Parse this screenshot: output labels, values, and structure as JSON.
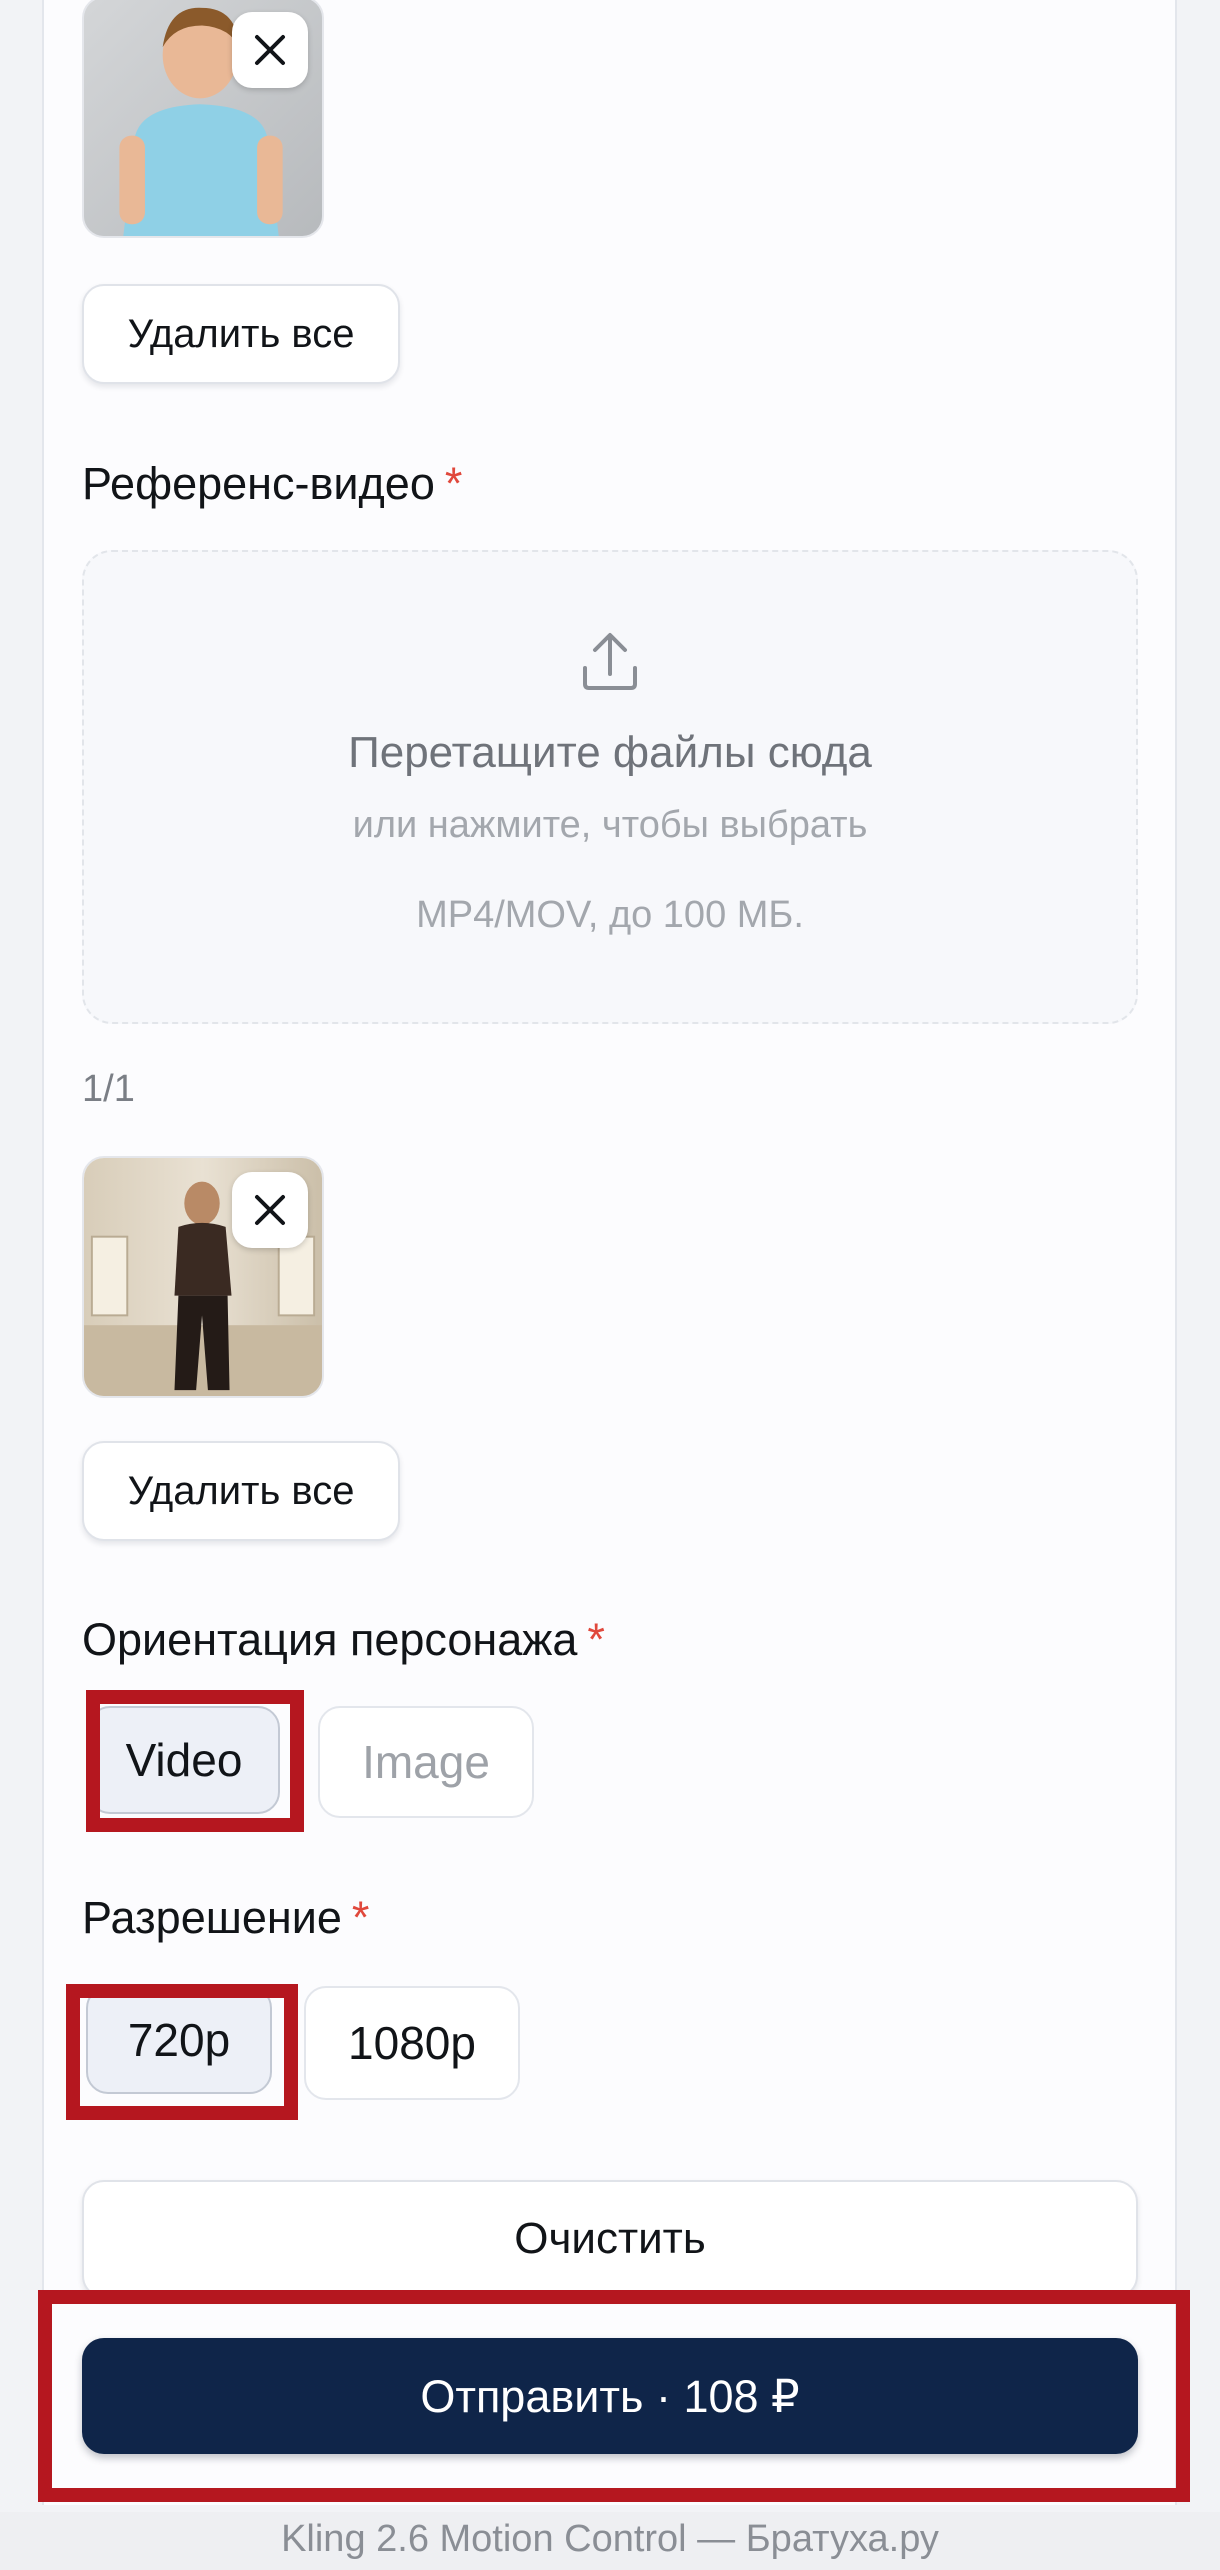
{
  "upload_character": {
    "delete_all_label": "Удалить все"
  },
  "reference_video": {
    "label": "Референс-видео",
    "required_mark": "*",
    "dropzone": {
      "title": "Перетащите файлы сюда",
      "subtitle": "или нажмите, чтобы выбрать",
      "hint": "MP4/MOV, до 100 МБ."
    },
    "counter": "1/1",
    "delete_all_label": "Удалить все"
  },
  "orientation": {
    "label": "Ориентация персонажа",
    "required_mark": "*",
    "options": [
      "Video",
      "Image"
    ],
    "selected": "Video"
  },
  "resolution": {
    "label": "Разрешение",
    "required_mark": "*",
    "options": [
      "720p",
      "1080p"
    ],
    "selected": "720p"
  },
  "clear_label": "Очистить",
  "submit_label": "Отправить · 108 ₽",
  "footer_text": "Kling 2.6 Motion Control — Братуха.ру",
  "colors": {
    "submit_bg": "#0f2549",
    "required": "#e0483c",
    "highlight": "#b5171f"
  }
}
